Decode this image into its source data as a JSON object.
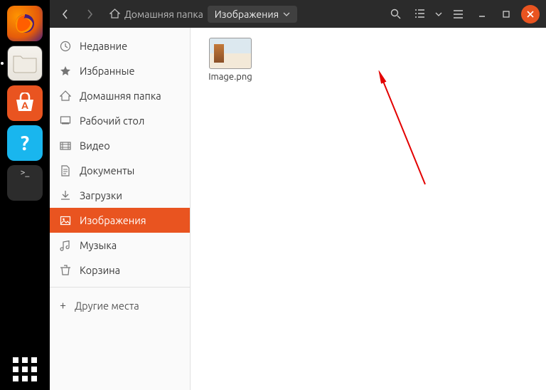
{
  "dock": {
    "firefox": "Firefox",
    "files": "Файлы",
    "software": "A",
    "help": "?",
    "terminal": ">_",
    "apps": "Показать приложения"
  },
  "titlebar": {
    "home_label": "Домашняя папка",
    "current": "Изображения"
  },
  "sidebar": {
    "items": [
      {
        "label": "Недавние"
      },
      {
        "label": "Избранные"
      },
      {
        "label": "Домашняя папка"
      },
      {
        "label": "Рабочий стол"
      },
      {
        "label": "Видео"
      },
      {
        "label": "Документы"
      },
      {
        "label": "Загрузки"
      },
      {
        "label": "Изображения"
      },
      {
        "label": "Музыка"
      },
      {
        "label": "Корзина"
      }
    ],
    "other": "Другие места"
  },
  "content": {
    "file_name": "Image.png"
  },
  "colors": {
    "accent": "#e95420"
  }
}
